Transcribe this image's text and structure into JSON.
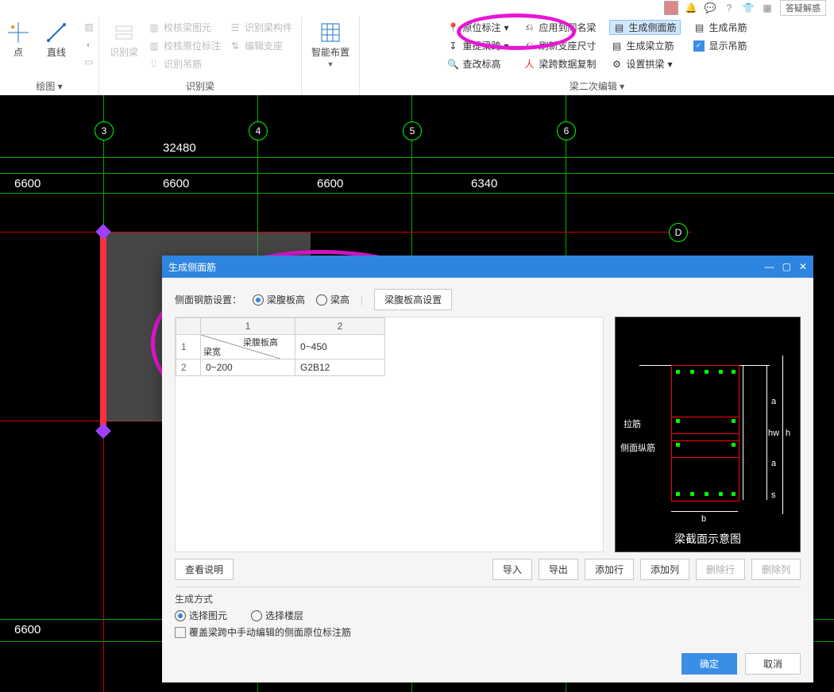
{
  "topstrip": {
    "help_label": "答疑解惑"
  },
  "ribbon": {
    "group_draw": {
      "label": "绘图",
      "point": "点",
      "line": "直线"
    },
    "group_recog": {
      "label": "识别梁",
      "recognize_beam": "识别梁",
      "check_beam_elem": "校核梁图元",
      "check_origin_mark": "校核原位标注",
      "recognize_stirrup": "识别吊筋",
      "recognize_beam_member": "识别梁构件",
      "edit_support": "编辑支座"
    },
    "group_smart": {
      "label": "智能布置",
      "btn": "智能布置"
    },
    "group_edit": {
      "label": "梁二次编辑",
      "col1": {
        "a": "原位标注",
        "b": "重提梁跨",
        "c": "查改标高"
      },
      "col2": {
        "a": "应用到同名梁",
        "b": "刷新支座尺寸",
        "c": "梁跨数据复制"
      },
      "col3": {
        "a": "生成侧面筋",
        "b": "生成梁立筋",
        "c": "设置拱梁"
      },
      "col4": {
        "a": "生成吊筋",
        "b": "显示吊筋"
      }
    }
  },
  "canvas": {
    "axes_top": [
      "3",
      "4",
      "5",
      "6"
    ],
    "axis_right": "D",
    "dim_total": "32480",
    "dims": [
      "6600",
      "6600",
      "6600",
      "6340"
    ],
    "dim_bottom": "6600"
  },
  "dialog": {
    "title": "生成侧面筋",
    "setting_label": "侧面钢筋设置：",
    "radio1": "梁腹板高",
    "radio2": "梁高",
    "btn_setting": "梁腹板高设置",
    "table": {
      "col_heads": [
        "1",
        "2"
      ],
      "diag_top": "梁腹板高",
      "diag_left": "梁宽",
      "row_heads": [
        "1",
        "2"
      ],
      "r1c2": "0~450",
      "r2c1": "0~200",
      "r2c2": "G2B12"
    },
    "preview": {
      "caption": "梁截面示意图",
      "lab_lajin": "拉筋",
      "lab_side": "侧面纵筋",
      "a": "a",
      "hw": "hw",
      "h": "h",
      "s": "s",
      "b": "b"
    },
    "btns": {
      "view_desc": "查看说明",
      "import": "导入",
      "export": "导出",
      "add_row": "添加行",
      "add_col": "添加列",
      "del_row": "删除行",
      "del_col": "删除列"
    },
    "gen": {
      "title": "生成方式",
      "by_elem": "选择图元",
      "by_floor": "选择楼层",
      "override": "覆盖梁跨中手动编辑的侧面原位标注筋"
    },
    "ok": "确定",
    "cancel": "取消"
  }
}
